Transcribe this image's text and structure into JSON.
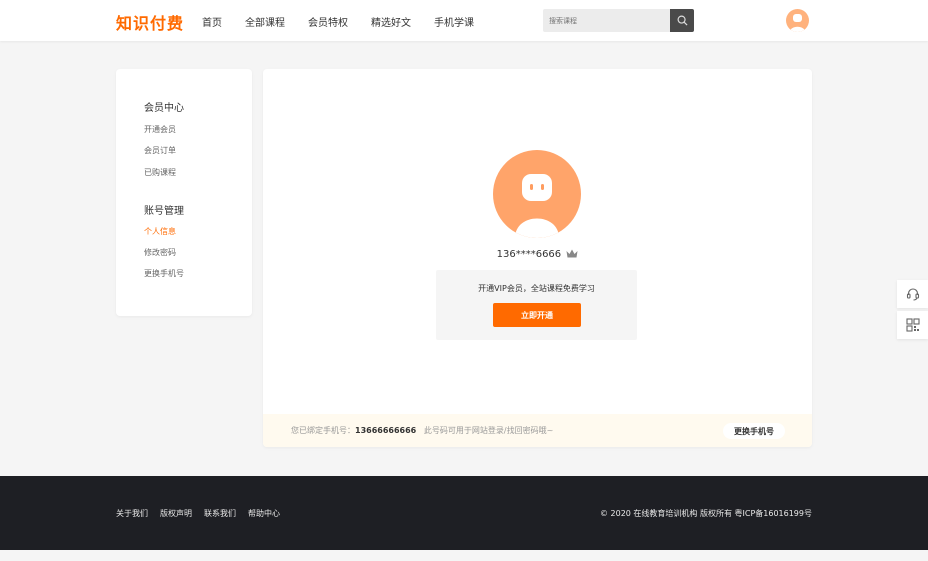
{
  "header": {
    "logo": "知识付费",
    "nav": [
      "首页",
      "全部课程",
      "会员特权",
      "精选好文",
      "手机学课"
    ],
    "search_placeholder": "搜索课程"
  },
  "sidebar": {
    "groups": [
      {
        "title": "会员中心",
        "items": [
          "开通会员",
          "会员订单",
          "已购课程"
        ]
      },
      {
        "title": "账号管理",
        "items": [
          "个人信息",
          "修改密码",
          "更换手机号"
        ]
      }
    ],
    "active_item": "个人信息"
  },
  "profile": {
    "phone_masked": "136****6666",
    "vip_text": "开通VIP会员，全站课程免费学习",
    "vip_button": "立即开通",
    "bind_prefix": "您已绑定手机号：",
    "bind_number": "13666666666",
    "bind_suffix": "此号码可用于网站登录/找回密码哦~",
    "change_phone_button": "更换手机号"
  },
  "footer": {
    "links": [
      "关于我们",
      "版权声明",
      "联系我们",
      "帮助中心"
    ],
    "copyright": "© 2020 在线教育培训机构 版权所有 粤ICP备16016199号"
  },
  "colors": {
    "accent": "#ff6a00",
    "footer_bg": "#1e1f24",
    "avatar_bg": "#ffa46a"
  },
  "icons": {
    "search": "search-icon",
    "crown": "crown-icon",
    "headset": "headset-icon",
    "qrcode": "qrcode-icon"
  }
}
